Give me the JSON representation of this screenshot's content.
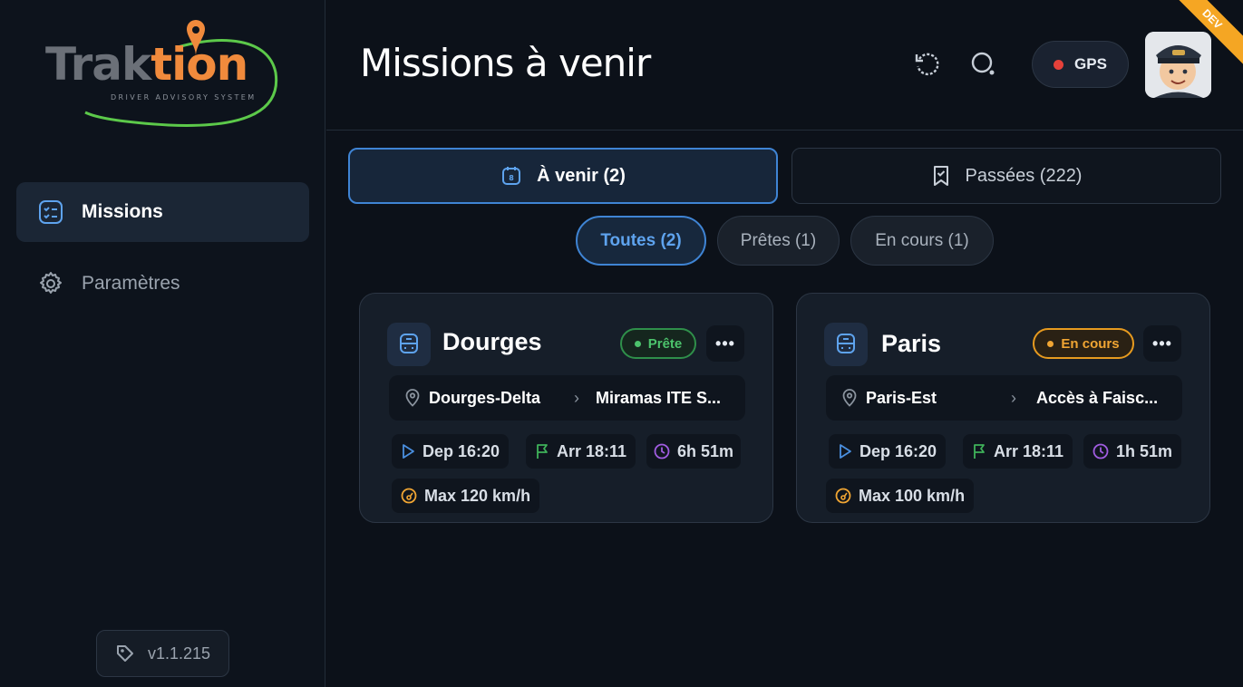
{
  "brand": {
    "logo_main": "Trak",
    "logo_accent": "tion",
    "logo_subtitle": "DRIVER ADVISORY SYSTEM"
  },
  "sidebar": {
    "items": [
      {
        "label": "Missions",
        "icon": "checklist-icon",
        "active": true
      },
      {
        "label": "Paramètres",
        "icon": "gear-icon",
        "active": false
      }
    ],
    "version": "v1.1.215"
  },
  "header": {
    "title": "Missions à venir",
    "gps_label": "GPS",
    "gps_status_color": "#e5413a",
    "env_ribbon": "DEV"
  },
  "tabs": [
    {
      "label": "À venir (2)",
      "icon": "calendar-icon",
      "active": true
    },
    {
      "label": "Passées (222)",
      "icon": "bookmark-check-icon",
      "active": false
    }
  ],
  "filters": [
    {
      "label": "Toutes (2)",
      "active": true
    },
    {
      "label": "Prêtes (1)",
      "active": false
    },
    {
      "label": "En cours (1)",
      "active": false
    }
  ],
  "missions": [
    {
      "title": "Dourges",
      "status": "Prête",
      "status_color": "#4cc36c",
      "from": "Dourges-Delta",
      "to": "Miramas ITE S...",
      "departure": "Dep 16:20",
      "arrival": "Arr 18:11",
      "duration": "6h 51m",
      "max_speed": "Max 120 km/h"
    },
    {
      "title": "Paris",
      "status": "En cours",
      "status_color": "#f0a533",
      "from": "Paris-Est",
      "to": "Accès à Faisc...",
      "departure": "Dep 16:20",
      "arrival": "Arr 18:11",
      "duration": "1h 51m",
      "max_speed": "Max 100 km/h"
    }
  ],
  "colors": {
    "accent": "#3f84d4",
    "ready": "#4cc36c",
    "in_progress": "#f0a533",
    "background": "#0c1119"
  }
}
